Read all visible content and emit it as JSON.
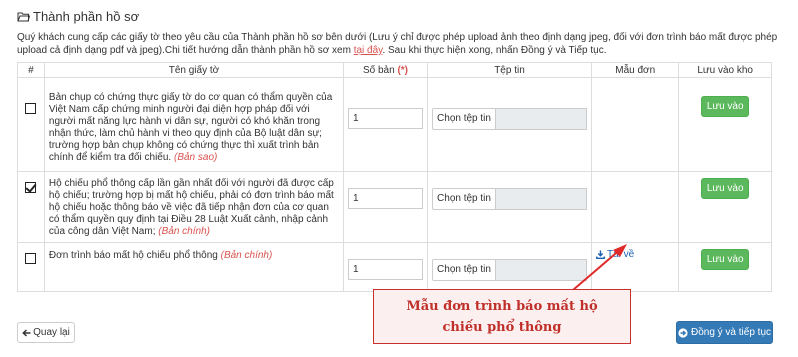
{
  "section": {
    "icon": "folder-open-icon",
    "title": "Thành phần hồ sơ"
  },
  "instructions": {
    "text_before": "Quý khách cung cấp các giấy tờ theo yêu cầu của Thành phần hồ sơ bên dưới (Lưu ý chỉ được phép upload ảnh theo định dạng jpeg, đối với đơn trình báo mất được phép upload cả định dạng pdf và jpeg).Chi tiết hướng dẫn thành phần hồ sơ xem ",
    "link_text": "tại đây",
    "text_after": ". Sau khi thực hiện xong, nhấn Đồng ý và Tiếp tục."
  },
  "table": {
    "headers": {
      "idx": "#",
      "name": "Tên giấy tờ",
      "qty": "Số bản",
      "qty_required": "(*)",
      "file": "Tệp tin",
      "form": "Mẫu đơn",
      "save": "Lưu vào kho"
    },
    "rows": [
      {
        "checked": false,
        "name": "Bản chụp có chứng thực giấy tờ do cơ quan có thẩm quyền của Việt Nam cấp chứng minh người đại diện hợp pháp đối với người mất năng lực hành vi dân sự, người có khó khăn trong nhận thức, làm chủ hành vi theo quy định của Bộ luật dân sự; trường hợp bản chụp không có chứng thực thì xuất trình bản chính để kiểm tra đối chiếu.",
        "tag": "(Bản sao)",
        "qty": "1",
        "file_button": "Chọn tệp tin",
        "save_button": "Lưu vào"
      },
      {
        "checked": true,
        "name": "Hộ chiếu phổ thông cấp lần gần nhất đối với người đã được cấp hộ chiếu; trường hợp bị mất hộ chiếu, phải có đơn trình báo mất hộ chiếu hoặc thông báo về việc đã tiếp nhận đơn của cơ quan có thẩm quyền quy định tại Điều 28 Luật Xuất cảnh, nhập cảnh của công dân Việt Nam;",
        "tag": "(Bản chính)",
        "qty": "1",
        "file_button": "Chọn tệp tin",
        "save_button": "Lưu vào"
      },
      {
        "checked": false,
        "name": "Đơn trình báo mất hộ chiếu phổ thông",
        "tag": "(Bản chính)",
        "qty": "1",
        "file_button": "Chọn tệp tin",
        "download_icon": "download-icon",
        "download_label": "Tải về",
        "save_button": "Lưu vào"
      }
    ]
  },
  "callout": {
    "line1": "Mẫu đơn trình báo mất hộ",
    "line2": "chiếu phổ thông"
  },
  "footer": {
    "back_label": "Quay lại",
    "next_label": "Đồng ý và tiếp tục"
  },
  "colors": {
    "accent_red": "#d9534f",
    "save_green": "#5cb85c",
    "primary_blue": "#337ab7",
    "arrow_red": "#e02a2a"
  }
}
